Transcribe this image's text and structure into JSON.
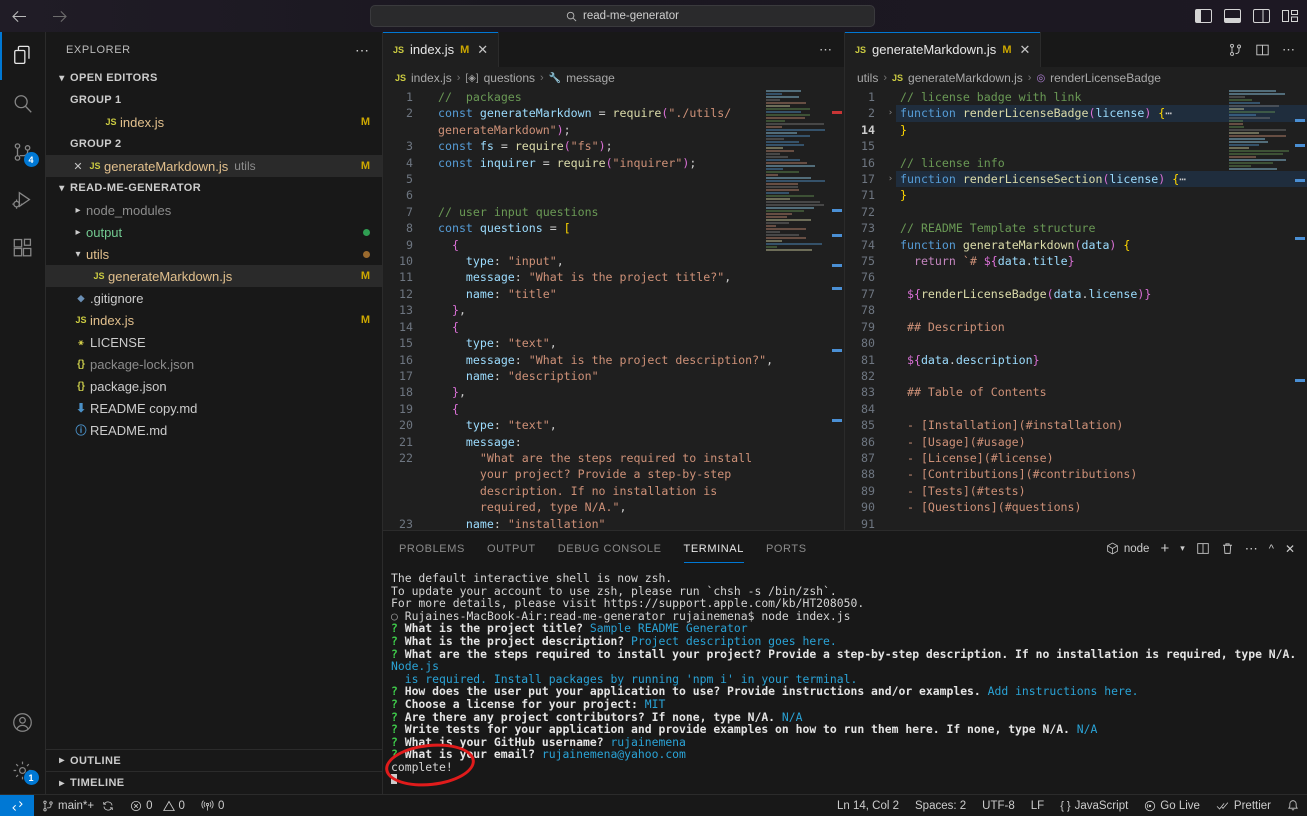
{
  "titlebar": {
    "back_icon": "arrow-left-icon",
    "forward_icon": "arrow-right-icon",
    "search_text": "read-me-generator",
    "search_icon": "search-icon",
    "layout_icons": [
      "toggle-primary-sidebar-icon",
      "toggle-panel-icon",
      "toggle-secondary-sidebar-icon",
      "customize-layout-icon"
    ]
  },
  "activitybar": {
    "items": [
      {
        "name": "explorer",
        "icon": "files-icon",
        "active": true,
        "badge": ""
      },
      {
        "name": "search",
        "icon": "search-icon",
        "active": false,
        "badge": ""
      },
      {
        "name": "source-control",
        "icon": "source-control-icon",
        "active": false,
        "badge": "4"
      },
      {
        "name": "run-and-debug",
        "icon": "run-debug-icon",
        "active": false,
        "badge": ""
      },
      {
        "name": "extensions",
        "icon": "extensions-icon",
        "active": false,
        "badge": ""
      }
    ],
    "bottom": [
      {
        "name": "accounts",
        "icon": "account-icon",
        "badge": ""
      },
      {
        "name": "manage",
        "icon": "gear-icon",
        "badge": "1"
      }
    ]
  },
  "sidebar": {
    "title": "EXPLORER",
    "more_icon": "ellipsis-icon",
    "open_editors": {
      "label": "OPEN EDITORS",
      "groups": [
        {
          "label": "GROUP 1",
          "items": [
            {
              "name": "index.js",
              "icon": "js-icon",
              "modified": "M",
              "selected": false,
              "close": false,
              "sub": ""
            }
          ]
        },
        {
          "label": "GROUP 2",
          "items": [
            {
              "name": "generateMarkdown.js",
              "icon": "js-icon",
              "modified": "M",
              "selected": true,
              "close": true,
              "sub": "utils"
            }
          ]
        }
      ]
    },
    "project": {
      "label": "READ-ME-GENERATOR",
      "entries": [
        {
          "name": "node_modules",
          "kind": "folder",
          "expanded": false,
          "color": "dim",
          "badge": "",
          "modified": ""
        },
        {
          "name": "output",
          "kind": "folder",
          "expanded": false,
          "color": "green",
          "badge": "dot-green",
          "modified": ""
        },
        {
          "name": "utils",
          "kind": "folder",
          "expanded": true,
          "color": "yellow",
          "badge": "dot-yellow",
          "modified": ""
        },
        {
          "name": "generateMarkdown.js",
          "kind": "file",
          "icon": "js-icon",
          "color": "yellow",
          "modified": "M",
          "selected": true,
          "indent": 2
        },
        {
          "name": ".gitignore",
          "kind": "file",
          "icon": "git-icon",
          "color": "normal",
          "modified": ""
        },
        {
          "name": "index.js",
          "kind": "file",
          "icon": "js-icon",
          "color": "yellow",
          "modified": "M"
        },
        {
          "name": "LICENSE",
          "kind": "file",
          "icon": "license-icon",
          "color": "normal",
          "modified": ""
        },
        {
          "name": "package-lock.json",
          "kind": "file",
          "icon": "json-icon",
          "color": "dim",
          "modified": ""
        },
        {
          "name": "package.json",
          "kind": "file",
          "icon": "json-icon",
          "color": "normal",
          "modified": ""
        },
        {
          "name": "README copy.md",
          "kind": "file",
          "icon": "markdown-icon",
          "color": "normal",
          "modified": ""
        },
        {
          "name": "README.md",
          "kind": "file",
          "icon": "info-icon",
          "color": "normal",
          "modified": ""
        }
      ]
    },
    "footer": [
      {
        "label": "OUTLINE"
      },
      {
        "label": "TIMELINE"
      }
    ]
  },
  "editor_left": {
    "tab": {
      "label": "index.js",
      "icon": "js-icon",
      "modified": "M",
      "close_icon": "close-icon"
    },
    "tab_actions": [
      "ellipsis-icon"
    ],
    "breadcrumb": [
      "index.js",
      "questions",
      "message"
    ],
    "breadcrumb_icons": [
      "js-icon",
      "array-icon",
      "property-icon"
    ],
    "lines": [
      {
        "no": "1",
        "html": "<span class='c'>//  packages</span>"
      },
      {
        "no": "2",
        "html": "<span class='k'>const</span> <span class='v'>generateMarkdown</span> <span class='p'>=</span> <span class='f'>require</span><span class='mg'>(</span><span class='s'>\"./utils/</span>"
      },
      {
        "no": "",
        "html": "<span class='s'>generateMarkdown\"</span><span class='mg'>)</span><span class='p'>;</span>"
      },
      {
        "no": "3",
        "html": "<span class='k'>const</span> <span class='v'>fs</span> <span class='p'>=</span> <span class='f'>require</span><span class='mg'>(</span><span class='s'>\"fs\"</span><span class='mg'>)</span><span class='p'>;</span>"
      },
      {
        "no": "4",
        "html": "<span class='k'>const</span> <span class='v'>inquirer</span> <span class='p'>=</span> <span class='f'>require</span><span class='mg'>(</span><span class='s'>\"inquirer\"</span><span class='mg'>)</span><span class='p'>;</span>"
      },
      {
        "no": "5",
        "html": ""
      },
      {
        "no": "6",
        "html": ""
      },
      {
        "no": "7",
        "html": "<span class='c'>// user input questions</span>"
      },
      {
        "no": "8",
        "html": "<span class='k'>const</span> <span class='v'>questions</span> <span class='p'>=</span> <span class='y'>[</span>"
      },
      {
        "no": "9",
        "html": "  <span class='mg'>{</span>"
      },
      {
        "no": "10",
        "html": "    <span class='v'>type</span><span class='p'>:</span> <span class='s'>\"input\"</span><span class='p'>,</span>"
      },
      {
        "no": "11",
        "html": "    <span class='v'>message</span><span class='p'>:</span> <span class='s'>\"What is the project title?\"</span><span class='p'>,</span>"
      },
      {
        "no": "12",
        "html": "    <span class='v'>name</span><span class='p'>:</span> <span class='s'>\"title\"</span>"
      },
      {
        "no": "13",
        "html": "  <span class='mg'>}</span><span class='p'>,</span>"
      },
      {
        "no": "14",
        "html": "  <span class='mg'>{</span>"
      },
      {
        "no": "15",
        "html": "    <span class='v'>type</span><span class='p'>:</span> <span class='s'>\"text\"</span><span class='p'>,</span>"
      },
      {
        "no": "16",
        "html": "    <span class='v'>message</span><span class='p'>:</span> <span class='s'>\"What is the project description?\"</span><span class='p'>,</span>"
      },
      {
        "no": "17",
        "html": "    <span class='v'>name</span><span class='p'>:</span> <span class='s'>\"description\"</span>"
      },
      {
        "no": "18",
        "html": "  <span class='mg'>}</span><span class='p'>,</span>"
      },
      {
        "no": "19",
        "html": "  <span class='mg'>{</span>"
      },
      {
        "no": "20",
        "html": "    <span class='v'>type</span><span class='p'>:</span> <span class='s'>\"text\"</span><span class='p'>,</span>"
      },
      {
        "no": "21",
        "html": "    <span class='v'>message</span><span class='p'>:</span>"
      },
      {
        "no": "22",
        "html": "      <span class='s'>\"What are the steps required to install</span>"
      },
      {
        "no": "",
        "html": "      <span class='s'>your project? Provide a step-by-step</span>"
      },
      {
        "no": "",
        "html": "      <span class='s'>description. If no installation is</span>"
      },
      {
        "no": "",
        "html": "      <span class='s'>required, type N/A.\"</span><span class='p'>,</span>"
      },
      {
        "no": "23",
        "html": "    <span class='v'>name</span><span class='p'>:</span> <span class='s'>\"installation\"</span>"
      }
    ]
  },
  "editor_right": {
    "tab": {
      "label": "generateMarkdown.js",
      "icon": "js-icon",
      "modified": "M",
      "close_icon": "close-icon"
    },
    "tab_actions": [
      "split-changes-icon",
      "split-editor-icon",
      "ellipsis-icon"
    ],
    "breadcrumb": [
      "utils",
      "generateMarkdown.js",
      "renderLicenseBadge"
    ],
    "breadcrumb_icons": [
      "folder-icon",
      "js-icon",
      "method-icon"
    ],
    "lines": [
      {
        "no": "1",
        "html": "<span class='c'>// license badge with link</span>"
      },
      {
        "no": "2",
        "html": "<span class='k'>function</span> <span class='f'>renderLicenseBadge</span><span class='mg'>(</span><span class='v'>license</span><span class='mg'>)</span> <span class='y'>{</span><span class='p'>⋯</span>",
        "fold": "›",
        "hl": true
      },
      {
        "no": "14",
        "html": "<span class='y'>}</span>",
        "cur": true
      },
      {
        "no": "15",
        "html": ""
      },
      {
        "no": "16",
        "html": "<span class='c'>// license info</span>"
      },
      {
        "no": "17",
        "html": "<span class='k'>function</span> <span class='f'>renderLicenseSection</span><span class='mg'>(</span><span class='v'>license</span><span class='mg'>)</span> <span class='y'>{</span><span class='p'>⋯</span>",
        "fold": "›",
        "hl": true
      },
      {
        "no": "71",
        "html": "<span class='y'>}</span>"
      },
      {
        "no": "72",
        "html": ""
      },
      {
        "no": "73",
        "html": "<span class='c'>// README Template structure</span>"
      },
      {
        "no": "74",
        "html": "<span class='k'>function</span> <span class='f'>generateMarkdown</span><span class='mg'>(</span><span class='v'>data</span><span class='mg'>)</span> <span class='y'>{</span>"
      },
      {
        "no": "75",
        "html": "  <span class='pk'>return</span> <span class='s'>`# </span><span class='mg'>${</span><span class='v'>data</span><span class='p'>.</span><span class='v'>title</span><span class='mg'>}</span>"
      },
      {
        "no": "76",
        "html": ""
      },
      {
        "no": "77",
        "html": " <span class='mg'>${</span><span class='f'>renderLicenseBadge</span><span class='mg'>(</span><span class='v'>data</span><span class='p'>.</span><span class='v'>license</span><span class='mg'>)}</span>"
      },
      {
        "no": "78",
        "html": ""
      },
      {
        "no": "79",
        "html": " <span class='s'>## Description</span>"
      },
      {
        "no": "80",
        "html": ""
      },
      {
        "no": "81",
        "html": " <span class='mg'>${</span><span class='v'>data</span><span class='p'>.</span><span class='v'>description</span><span class='mg'>}</span>"
      },
      {
        "no": "82",
        "html": ""
      },
      {
        "no": "83",
        "html": " <span class='s'>## Table of Contents</span>"
      },
      {
        "no": "84",
        "html": ""
      },
      {
        "no": "85",
        "html": " <span class='s'>- [Installation](#installation)</span>"
      },
      {
        "no": "86",
        "html": " <span class='s'>- [Usage](#usage)</span>"
      },
      {
        "no": "87",
        "html": " <span class='s'>- [License](#license)</span>"
      },
      {
        "no": "88",
        "html": " <span class='s'>- [Contributions](#contributions)</span>"
      },
      {
        "no": "89",
        "html": " <span class='s'>- [Tests](#tests)</span>"
      },
      {
        "no": "90",
        "html": " <span class='s'>- [Questions](#questions)</span>"
      },
      {
        "no": "91",
        "html": ""
      }
    ]
  },
  "panel": {
    "tabs": [
      {
        "label": "PROBLEMS",
        "active": false
      },
      {
        "label": "OUTPUT",
        "active": false
      },
      {
        "label": "DEBUG CONSOLE",
        "active": false
      },
      {
        "label": "TERMINAL",
        "active": true
      },
      {
        "label": "PORTS",
        "active": false
      }
    ],
    "shell_label": "node",
    "shell_icon": "node-icon",
    "actions": [
      "new-terminal-icon",
      "chevron-down-icon",
      "split-terminal-icon",
      "kill-terminal-icon",
      "ellipsis-icon",
      "maximize-panel-icon",
      "close-panel-icon"
    ],
    "terminal_lines": [
      {
        "html": "<span class='t-w'>The default interactive shell is now zsh.</span>"
      },
      {
        "html": "<span class='t-w'>To update your account to use zsh, please run `chsh -s /bin/zsh`.</span>"
      },
      {
        "html": "<span class='t-w'>For more details, please visit https://support.apple.com/kb/HT208050.</span>"
      },
      {
        "html": "<span class='bullet-o'>○ </span><span class='t-w'>Rujaines-MacBook-Air:read-me-generator rujainemena$ node index.js</span>"
      },
      {
        "html": "<span class='t-q'>? </span><span class='t-bold'>What is the project title? </span><span class='t-b'>Sample README Generator</span>"
      },
      {
        "html": "<span class='t-q'>? </span><span class='t-bold'>What is the project description? </span><span class='t-b'>Project description goes here.</span>"
      },
      {
        "html": "<span class='t-q'>? </span><span class='t-bold'>What are the steps required to install your project? Provide a step-by-step description. If no installation is required, type N/A. </span><span class='t-b'>Node.js</span>"
      },
      {
        "html": "<span class='t-b'>  is required. Install packages by running 'npm i' in your terminal.</span>"
      },
      {
        "html": "<span class='t-q'>? </span><span class='t-bold'>How does the user put your application to use? Provide instructions and/or examples. </span><span class='t-b'>Add instructions here.</span>"
      },
      {
        "html": "<span class='t-q'>? </span><span class='t-bold'>Choose a license for your project: </span><span class='t-b'>MIT</span>"
      },
      {
        "html": "<span class='t-q'>? </span><span class='t-bold'>Are there any project contributors? If none, type N/A. </span><span class='t-b'>N/A</span>"
      },
      {
        "html": "<span class='t-q'>? </span><span class='t-bold'>Write tests for your application and provide examples on how to run them here. If none, type N/A. </span><span class='t-b'>N/A</span>"
      },
      {
        "html": "<span class='t-q'>? </span><span class='t-bold'>What is your GitHub username? </span><span class='t-b'>rujainemena</span>"
      },
      {
        "html": "<span class='t-q'>? </span><span class='t-bold'>What is your email? </span><span class='t-b'>rujainemena@yahoo.com</span>"
      },
      {
        "html": "<span class='t-w'>complete!</span>"
      },
      {
        "html": "<span class='cursor-blk'></span>"
      }
    ],
    "annotation": {
      "shape": "red-ellipse",
      "color": "#e01b1b",
      "around": "complete!"
    }
  },
  "statusbar": {
    "remote_icon": "remote-window-icon",
    "left": [
      {
        "name": "branch",
        "icon": "source-control-icon",
        "label": "main*+"
      },
      {
        "name": "sync",
        "icon": "sync-icon",
        "label": ""
      },
      {
        "name": "errors",
        "icon": "error-icon",
        "label": "0"
      },
      {
        "name": "warnings",
        "icon": "warning-icon",
        "label": "0"
      },
      {
        "name": "ports",
        "icon": "radio-tower-icon",
        "label": "0"
      }
    ],
    "right": [
      {
        "name": "cursor-position",
        "label": "Ln 14, Col 2"
      },
      {
        "name": "indentation",
        "label": "Spaces: 2"
      },
      {
        "name": "encoding",
        "label": "UTF-8"
      },
      {
        "name": "eol",
        "label": "LF"
      },
      {
        "name": "language-mode",
        "label": "JavaScript",
        "icon": "braces-icon"
      },
      {
        "name": "go-live",
        "label": "Go Live",
        "icon": "broadcast-icon"
      },
      {
        "name": "prettier",
        "label": "Prettier",
        "icon": "check-check-icon"
      },
      {
        "name": "notifications",
        "label": "",
        "icon": "bell-icon"
      }
    ]
  }
}
